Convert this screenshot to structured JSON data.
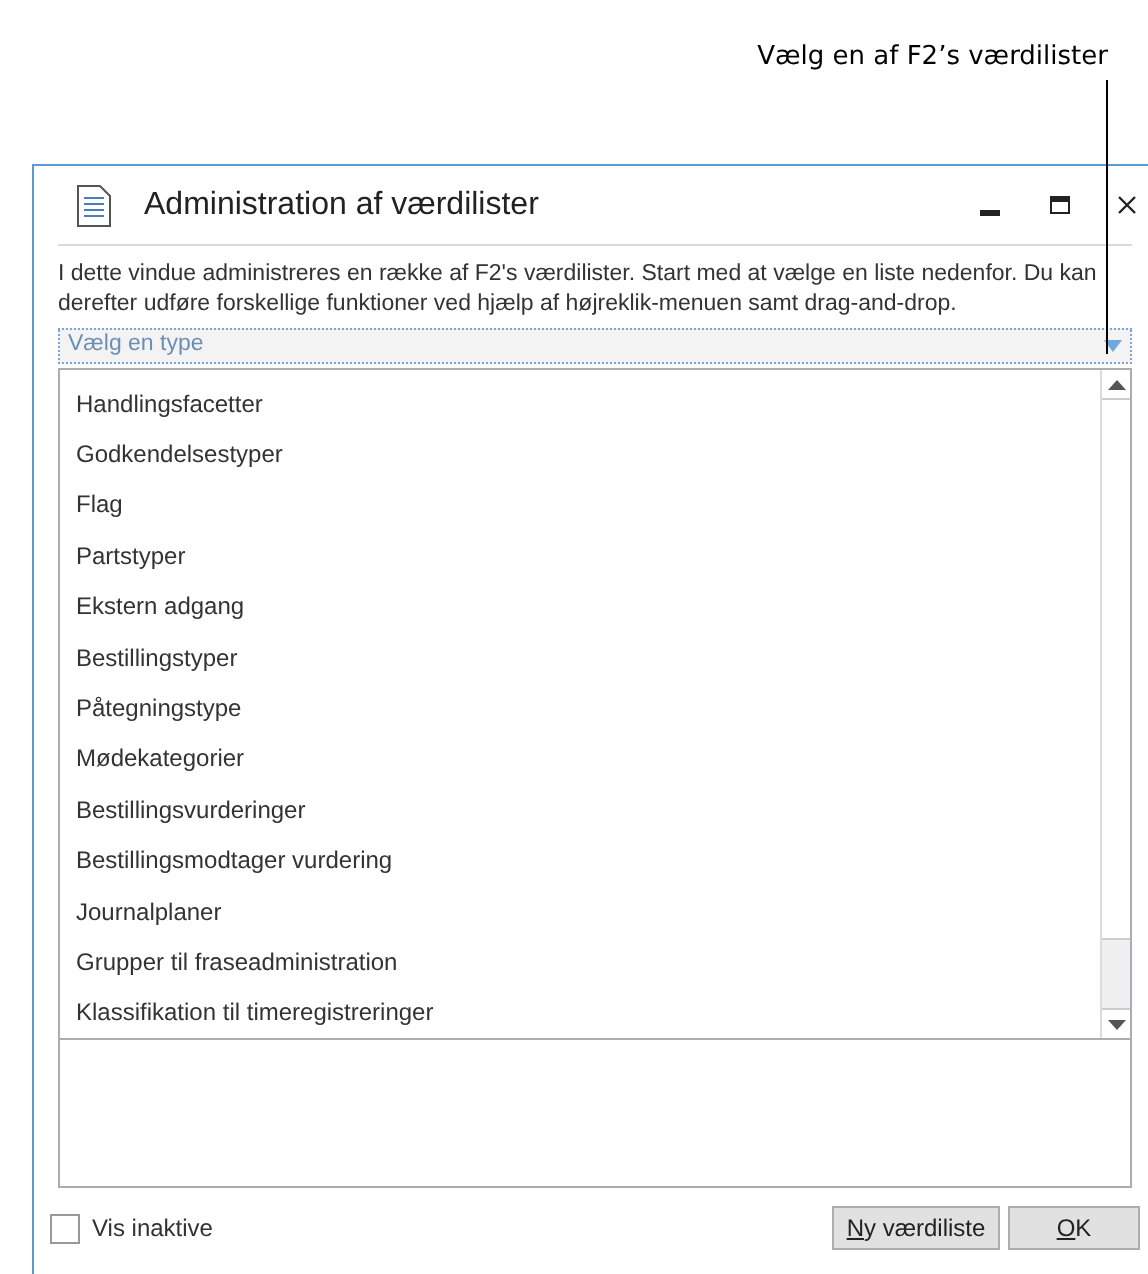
{
  "callout": {
    "text": "Vælg en af F2’s værdilister"
  },
  "window": {
    "title": "Administration af værdilister"
  },
  "description": "I dette vindue administreres en række af F2's værdilister. Start med at vælge en liste nedenfor. Du kan derefter udføre forskellige funktioner ved hjælp af højreklik-menuen samt drag-and-drop.",
  "type_dropdown": {
    "placeholder": "Vælg en type"
  },
  "list_items": [
    {
      "label": "Handlingsfacetter"
    },
    {
      "label": "Godkendelsestyper"
    },
    {
      "label": "Flag"
    },
    {
      "label": "Partstyper"
    },
    {
      "label": "Ekstern adgang"
    },
    {
      "label": "Bestillingstyper"
    },
    {
      "label": "Påtegningstype"
    },
    {
      "label": "Mødekategorier"
    },
    {
      "label": "Bestillingsvurderinger"
    },
    {
      "label": "Bestillingsmodtager vurdering"
    },
    {
      "label": "Journalplaner"
    },
    {
      "label": "Grupper til fraseadministration"
    },
    {
      "label": "Klassifikation til timeregistreringer"
    }
  ],
  "show_inactive": {
    "label": "Vis inaktive",
    "checked": false
  },
  "buttons": [
    {
      "label": "Ny værdiliste"
    },
    {
      "label": "OK"
    }
  ]
}
